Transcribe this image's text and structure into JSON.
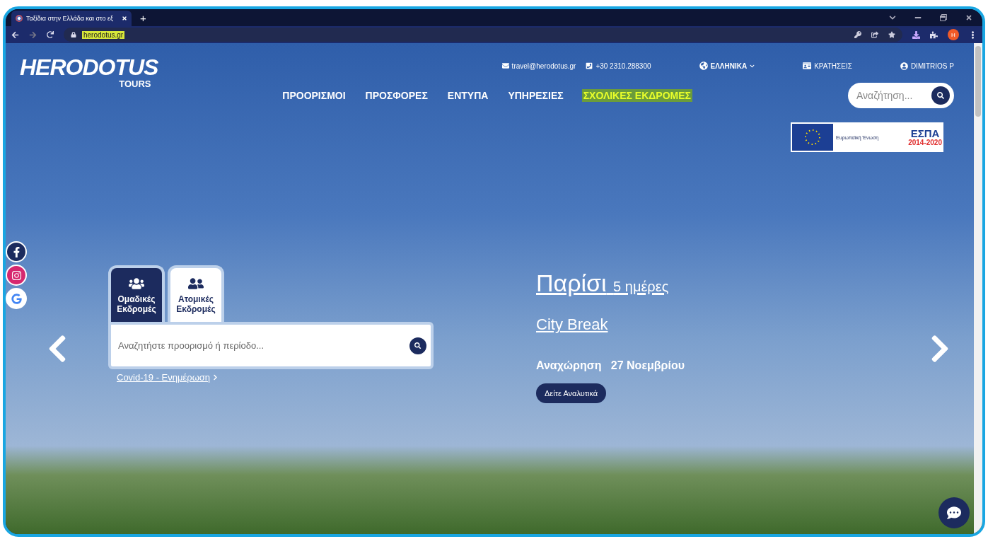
{
  "browser": {
    "tab_title": "Ταξίδια στην Ελλάδα και στο εξ",
    "new_tab": "+",
    "url": "herodotus.gr",
    "profile_initial": "H"
  },
  "header": {
    "logo_name": "HERODOTUS",
    "logo_tagline": "TOURS",
    "email": "travel@herodotus.gr",
    "phone": "+30 2310.288300",
    "language": "ΕΛΛΗΝΙΚΑ",
    "bookings": "ΚΡΑΤΗΣΕΙΣ",
    "user": "DIMITRIOS P",
    "nav": [
      {
        "label": "ΠΡΟΟΡΙΣΜΟΙ",
        "highlighted": false
      },
      {
        "label": "ΠΡΟΣΦΟΡΕΣ",
        "highlighted": false
      },
      {
        "label": "ΕΝΤΥΠΑ",
        "highlighted": false
      },
      {
        "label": "ΥΠΗΡΕΣΙΕΣ",
        "highlighted": false
      },
      {
        "label": "ΣΧΟΛΙΚΕΣ ΕΚΔΡΟΜΕΣ",
        "highlighted": true
      }
    ],
    "search": {
      "placeholder": "Αναζήτηση..."
    },
    "banner": {
      "eu_label": "Ευρωπαϊκή Ένωση",
      "program": "ΕΣΠΑ",
      "years": "2014-2020"
    }
  },
  "trip_search": {
    "tabs": [
      {
        "label": "Ομαδικές Εκδρομές",
        "kind": "group",
        "selected": true
      },
      {
        "label": "Ατομικές Εκδρομές",
        "kind": "individual",
        "selected": false
      }
    ],
    "placeholder": "Αναζητήστε προορισμό ή περίοδο...",
    "link": "Covid-19 - Ενημέρωση"
  },
  "slide": {
    "title": "Παρίσι",
    "duration": "5 ημέρες",
    "category": "City Break",
    "departure_label": "Αναχώρηση",
    "departure_date": "27 Νοεμβρίου",
    "button": "Δείτε Αναλυτικά"
  }
}
